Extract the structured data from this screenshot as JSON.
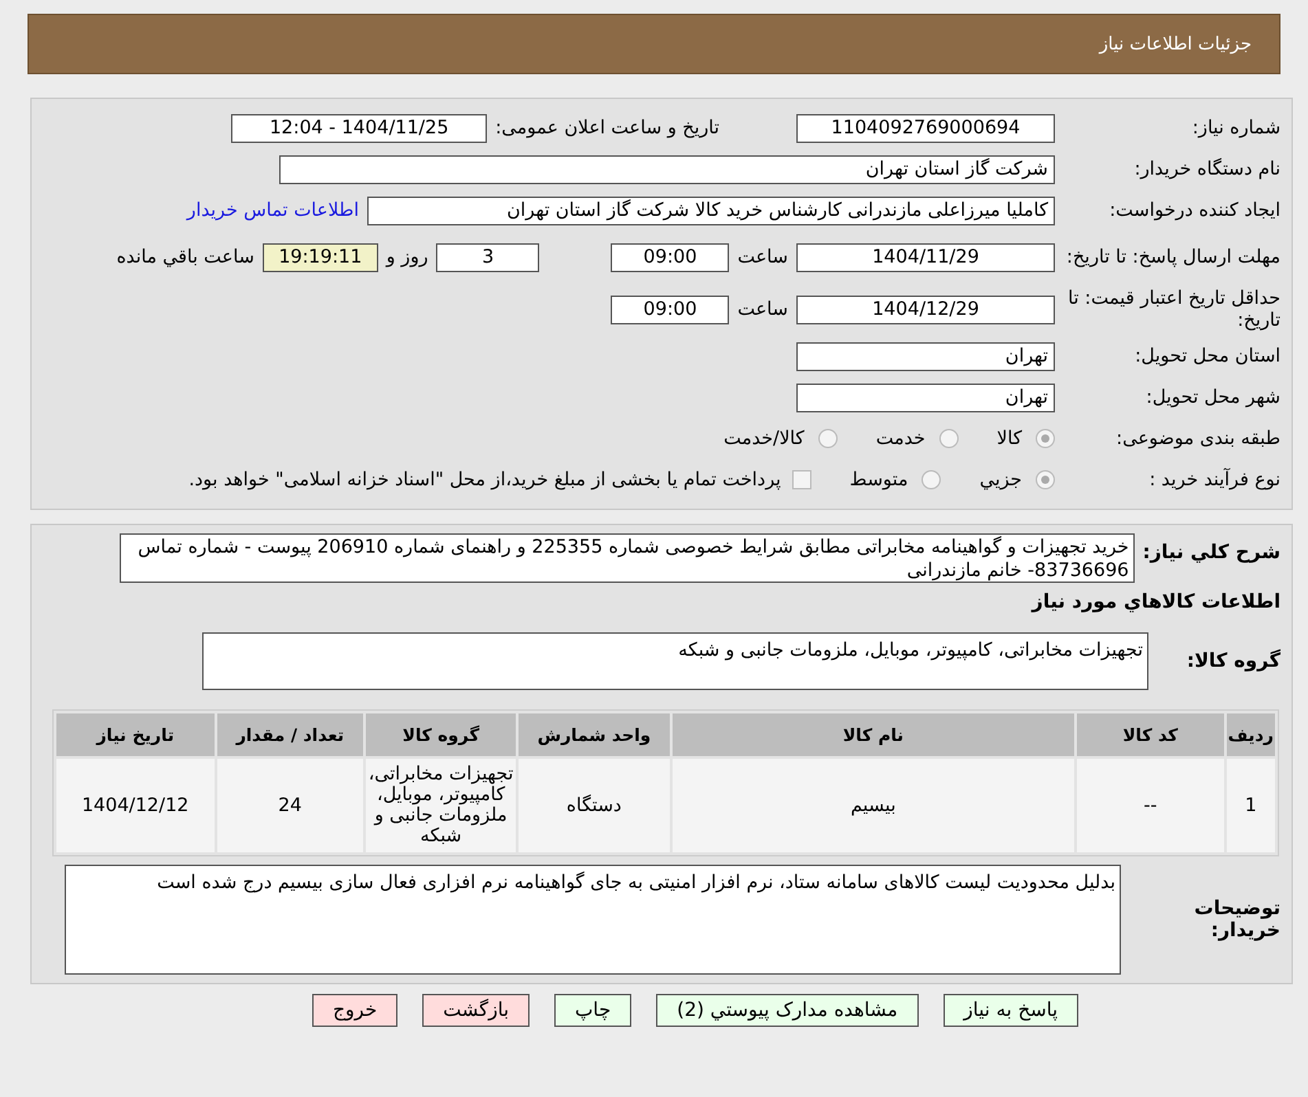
{
  "header": {
    "title": "جزئیات اطلاعات نیاز"
  },
  "need_number": {
    "label": "شماره نیاز:",
    "value": "1104092769000694"
  },
  "announce": {
    "label": "تاریخ و ساعت اعلان عمومی:",
    "value": "1404/11/25 - 12:04"
  },
  "buyer_org": {
    "label": "نام دستگاه خریدار:",
    "value": "شرکت گاز استان تهران"
  },
  "requester": {
    "label": "ایجاد کننده درخواست:",
    "value": "کاملیا میرزاعلی مازندرانی کارشناس خرید کالا شرکت گاز استان تهران",
    "link": "اطلاعات تماس خریدار"
  },
  "reply_deadline": {
    "label": "مهلت ارسال پاسخ: تا تاریخ:",
    "date": "1404/11/29",
    "time_label": "ساعت",
    "time": "09:00",
    "days": "3",
    "days_label": "روز و",
    "remaining": "19:19:11",
    "remaining_label": "ساعت باقي مانده"
  },
  "price_validity": {
    "label": "حداقل تاریخ اعتبار قیمت: تا تاریخ:",
    "date": "1404/12/29",
    "time_label": "ساعت",
    "time": "09:00"
  },
  "province": {
    "label": "استان محل تحویل:",
    "value": "تهران"
  },
  "city": {
    "label": "شهر محل تحویل:",
    "value": "تهران"
  },
  "category": {
    "label": "طبقه بندی موضوعی:",
    "options": [
      {
        "label": "کالا",
        "selected": true
      },
      {
        "label": "خدمت",
        "selected": false
      },
      {
        "label": "کالا/خدمت",
        "selected": false
      }
    ]
  },
  "process": {
    "label": "نوع فرآیند خرید :",
    "options": [
      {
        "label": "جزيي",
        "selected": true
      },
      {
        "label": "متوسط",
        "selected": false
      }
    ],
    "payment": {
      "checked": false,
      "label": "پرداخت تمام یا بخشی از مبلغ خرید،از محل \"اسناد خزانه اسلامی\" خواهد بود."
    }
  },
  "description": {
    "label": "شرح کلي نياز:",
    "value": "خرید تجهیزات و گواهینامه مخابراتی مطابق شرایط خصوصی شماره 225355 و راهنمای شماره 206910 پیوست - شماره تماس 83736696- خانم مازندرانی"
  },
  "goods_title": "اطلاعات کالاهاي مورد نياز",
  "goods_group": {
    "label": "گروه کالا:",
    "value": "تجهیزات مخابراتی، کامپیوتر، موبایل، ملزومات جانبی و شبکه"
  },
  "table": {
    "columns": [
      "رديف",
      "کد کالا",
      "نام کالا",
      "واحد شمارش",
      "گروه کالا",
      "تعداد / مقدار",
      "تاریخ نیاز"
    ],
    "rows": [
      [
        "1",
        "--",
        "بیسیم",
        "دستگاه",
        "تجهیزات مخابراتی، کامپیوتر، موبایل، ملزومات جانبی و شبکه",
        "24",
        "1404/12/12"
      ]
    ]
  },
  "buyer_notes": {
    "label": "توضیحات خریدار:",
    "value": "بدلیل محدودیت لیست کالاهای سامانه ستاد، نرم افزار امنیتی به جای گواهینامه نرم افزاری فعال سازی بیسیم درج شده است"
  },
  "buttons": [
    {
      "label": "پاسخ به نیاز",
      "kind": "normal"
    },
    {
      "label": "مشاهده مدارک پیوستي (2)",
      "kind": "normal"
    },
    {
      "label": "چاپ",
      "kind": "normal"
    },
    {
      "label": "بازگشت",
      "kind": "danger"
    },
    {
      "label": "خروج",
      "kind": "danger"
    }
  ]
}
